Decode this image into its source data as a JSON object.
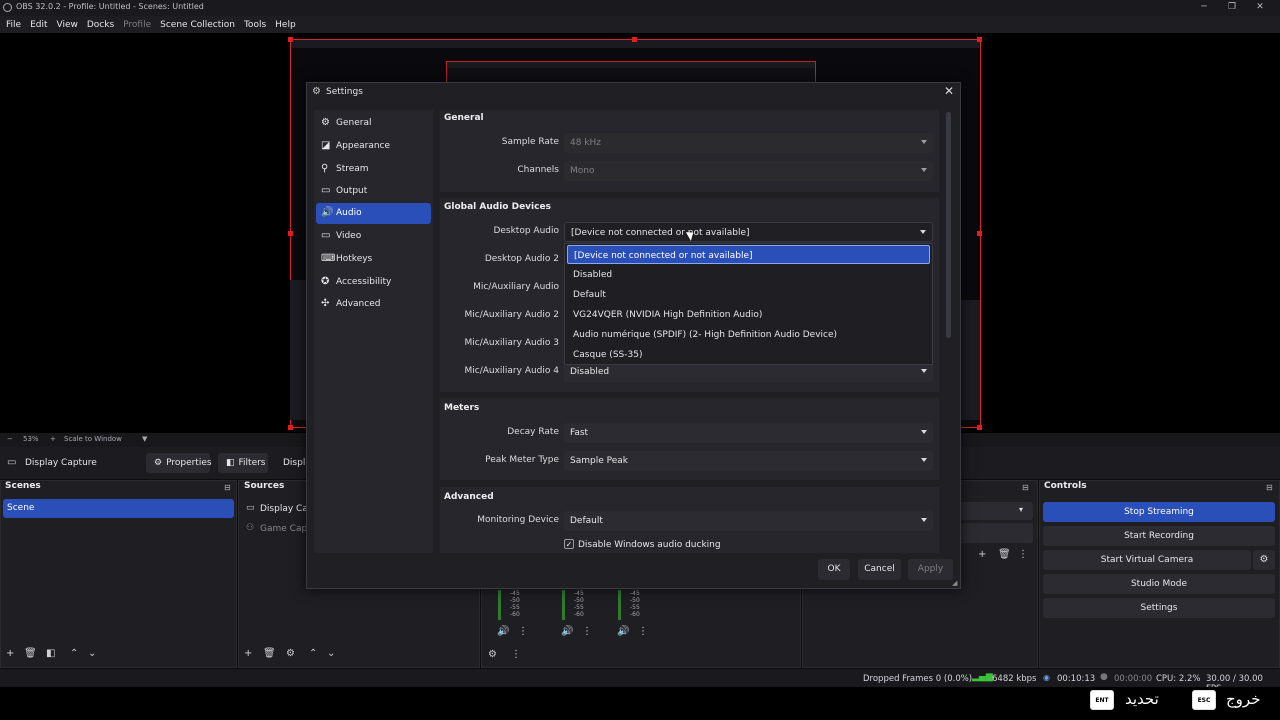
{
  "window": {
    "title": "OBS 32.0.2 - Profile: Untitled - Scenes: Untitled"
  },
  "menu": [
    "File",
    "Edit",
    "View",
    "Docks",
    "Profile",
    "Scene Collection",
    "Tools",
    "Help"
  ],
  "preview_toolbar": {
    "zoom": "53%",
    "scale_mode": "Scale to Window"
  },
  "source_bar": {
    "selected_source": "Display Capture",
    "properties": "Properties",
    "filters": "Filters",
    "truncated": "Displa"
  },
  "scenes": {
    "header": "Scenes",
    "items": [
      "Scene"
    ]
  },
  "sources": {
    "header": "Sources",
    "items": [
      "Display Capt",
      "Game Captu"
    ]
  },
  "mixer": {
    "ticks": [
      "-45",
      "-50",
      "-55",
      "-60"
    ]
  },
  "controls": {
    "header": "Controls",
    "buttons": [
      "Stop Streaming",
      "Start Recording",
      "Start Virtual Camera",
      "Studio Mode",
      "Settings"
    ]
  },
  "status": {
    "dropped": "Dropped Frames 0 (0.0%)",
    "bitrate": "6482 kbps",
    "stream_time": "00:10:13",
    "rec_time": "00:00:00",
    "cpu": "CPU: 2.2%",
    "fps": "30.00 / 30.00 FPS"
  },
  "taskbar_hints": {
    "update": "تحديد",
    "exit": "خروج",
    "ent": "ENT",
    "esc": "ESC"
  },
  "settings": {
    "title": "Settings",
    "nav": [
      "General",
      "Appearance",
      "Stream",
      "Output",
      "Audio",
      "Video",
      "Hotkeys",
      "Accessibility",
      "Advanced"
    ],
    "selected_nav": "Audio",
    "general": {
      "header": "General",
      "sample_rate_label": "Sample Rate",
      "sample_rate": "48 kHz",
      "channels_label": "Channels",
      "channels": "Mono"
    },
    "devices": {
      "header": "Global Audio Devices",
      "labels": [
        "Desktop Audio",
        "Desktop Audio 2",
        "Mic/Auxiliary Audio",
        "Mic/Auxiliary Audio 2",
        "Mic/Auxiliary Audio 3",
        "Mic/Auxiliary Audio 4"
      ],
      "desktop_audio": "[Device not connected or not available]",
      "mic4": "Disabled"
    },
    "dropdown": [
      "[Device not connected or not available]",
      "Disabled",
      "Default",
      "VG24VQER (NVIDIA High Definition Audio)",
      "Audio numérique (SPDIF) (2- High Definition Audio Device)",
      "Casque (SS-35)"
    ],
    "meters": {
      "header": "Meters",
      "decay_label": "Decay Rate",
      "decay": "Fast",
      "peak_label": "Peak Meter Type",
      "peak": "Sample Peak"
    },
    "advanced": {
      "header": "Advanced",
      "monitor_label": "Monitoring Device",
      "monitor": "Default",
      "ducking": "Disable Windows audio ducking"
    },
    "buttons": {
      "ok": "OK",
      "cancel": "Cancel",
      "apply": "Apply"
    }
  },
  "colors": {
    "accent": "#2a4fb8",
    "border_red": "#d4262a"
  }
}
